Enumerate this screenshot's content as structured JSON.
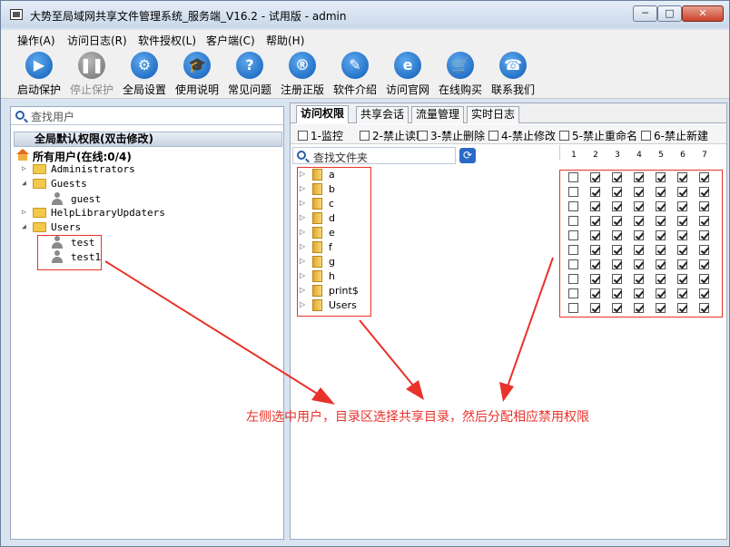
{
  "window": {
    "title": "大势至局域网共享文件管理系统_服务端_V16.2 - 试用版 - admin",
    "min": "─",
    "max": "□",
    "close": "✕"
  },
  "menu": [
    "操作(A)",
    "访问日志(R)",
    "软件授权(L)",
    "客户端(C)",
    "帮助(H)"
  ],
  "toolbar": [
    {
      "label": "启动保护",
      "icon": "play-icon",
      "glyph": "▶",
      "enabled": true
    },
    {
      "label": "停止保护",
      "icon": "pause-icon",
      "glyph": "❚❚",
      "enabled": false
    },
    {
      "label": "全局设置",
      "icon": "gear-icon",
      "glyph": "⚙",
      "enabled": true
    },
    {
      "label": "使用说明",
      "icon": "graduation-cap-icon",
      "glyph": "🎓",
      "enabled": true
    },
    {
      "label": "常见问题",
      "icon": "question-icon",
      "glyph": "?",
      "enabled": true
    },
    {
      "label": "注册正版",
      "icon": "registered-icon",
      "glyph": "®",
      "enabled": true
    },
    {
      "label": "软件介绍",
      "icon": "document-edit-icon",
      "glyph": "✎",
      "enabled": true
    },
    {
      "label": "访问官网",
      "icon": "ie-browser-icon",
      "glyph": "e",
      "enabled": true
    },
    {
      "label": "在线购买",
      "icon": "shopping-cart-icon",
      "glyph": "🛒",
      "enabled": true
    },
    {
      "label": "联系我们",
      "icon": "phone-icon",
      "glyph": "☎",
      "enabled": true
    }
  ],
  "left": {
    "search_placeholder": "查找用户",
    "global_perm": "全局默认权限(双击修改)",
    "all_users": "所有用户(在线:0/4)",
    "groups": [
      {
        "name": "Administrators",
        "expander": "▷",
        "members": []
      },
      {
        "name": "Guests",
        "expander": "◢",
        "members": [
          "guest"
        ]
      },
      {
        "name": "HelpLibraryUpdaters",
        "expander": "▷",
        "members": []
      },
      {
        "name": "Users",
        "expander": "◢",
        "members": [
          "test",
          "test1"
        ]
      }
    ]
  },
  "tabs": [
    "访问权限",
    "共享会话",
    "流量管理",
    "实时日志"
  ],
  "active_tab": 0,
  "permissions": [
    {
      "label": "1-监控",
      "checked": false
    },
    {
      "label": "2-禁止读取",
      "checked": false
    },
    {
      "label": "3-禁止删除",
      "checked": false
    },
    {
      "label": "4-禁止修改",
      "checked": false
    },
    {
      "label": "5-禁止重命名",
      "checked": false
    },
    {
      "label": "6-禁止新建",
      "checked": false
    }
  ],
  "folder_search_placeholder": "查找文件夹",
  "refresh_glyph": "⟳",
  "column_numbers": [
    "1",
    "2",
    "3",
    "4",
    "5",
    "6",
    "7"
  ],
  "folders": [
    {
      "name": "a",
      "perms": [
        false,
        true,
        true,
        true,
        true,
        true,
        true
      ]
    },
    {
      "name": "b",
      "perms": [
        false,
        true,
        true,
        true,
        true,
        true,
        true
      ]
    },
    {
      "name": "c",
      "perms": [
        false,
        true,
        true,
        true,
        true,
        true,
        true
      ]
    },
    {
      "name": "d",
      "perms": [
        false,
        true,
        true,
        true,
        true,
        true,
        true
      ]
    },
    {
      "name": "e",
      "perms": [
        false,
        true,
        true,
        true,
        true,
        true,
        true
      ]
    },
    {
      "name": "f",
      "perms": [
        false,
        true,
        true,
        true,
        true,
        true,
        true
      ]
    },
    {
      "name": "g",
      "perms": [
        false,
        true,
        true,
        true,
        true,
        true,
        true
      ]
    },
    {
      "name": "h",
      "perms": [
        false,
        true,
        true,
        true,
        true,
        true,
        true
      ]
    },
    {
      "name": "print$",
      "perms": [
        false,
        true,
        true,
        true,
        true,
        true,
        true
      ]
    },
    {
      "name": "Users",
      "perms": [
        false,
        true,
        true,
        true,
        true,
        true,
        true
      ]
    }
  ],
  "annotation": "左侧选中用户，目录区选择共享目录，然后分配相应禁用权限",
  "colors": {
    "annotation": "#e8322a",
    "accent": "#1a5fb4"
  }
}
